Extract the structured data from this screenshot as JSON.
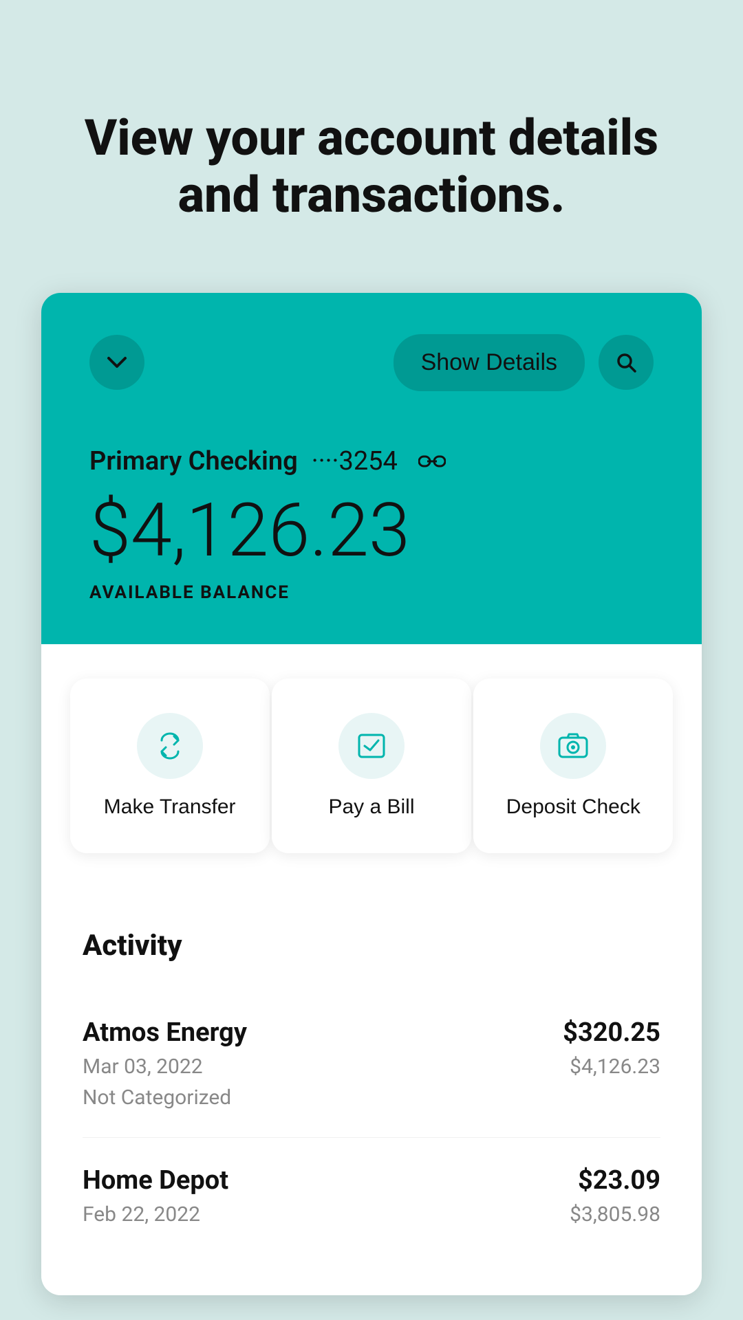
{
  "page": {
    "background_color": "#d4e9e7",
    "title": "View your account details and transactions."
  },
  "card": {
    "background_color": "#00b5ad",
    "chevron_label": "chevron down",
    "show_details_label": "Show Details",
    "search_label": "search",
    "account_name": "Primary Checking",
    "account_number": "····3254",
    "balance": "$4,126.23",
    "balance_label": "AVAILABLE BALANCE"
  },
  "actions": [
    {
      "id": "make-transfer",
      "label": "Make Transfer",
      "icon": "transfer"
    },
    {
      "id": "pay-bill",
      "label": "Pay a Bill",
      "icon": "bill"
    },
    {
      "id": "deposit-check",
      "label": "Deposit Check",
      "icon": "camera"
    }
  ],
  "activity": {
    "title": "Activity",
    "transactions": [
      {
        "name": "Atmos Energy",
        "date": "Mar 03, 2022",
        "category": "Not Categorized",
        "amount": "$320.25",
        "balance": "$4,126.23"
      },
      {
        "name": "Home Depot",
        "date": "Feb 22, 2022",
        "category": "",
        "amount": "$23.09",
        "balance": "$3,805.98"
      }
    ]
  },
  "colors": {
    "teal": "#00b5ad",
    "teal_light": "#e8f5f5",
    "bg": "#d4e9e7"
  }
}
